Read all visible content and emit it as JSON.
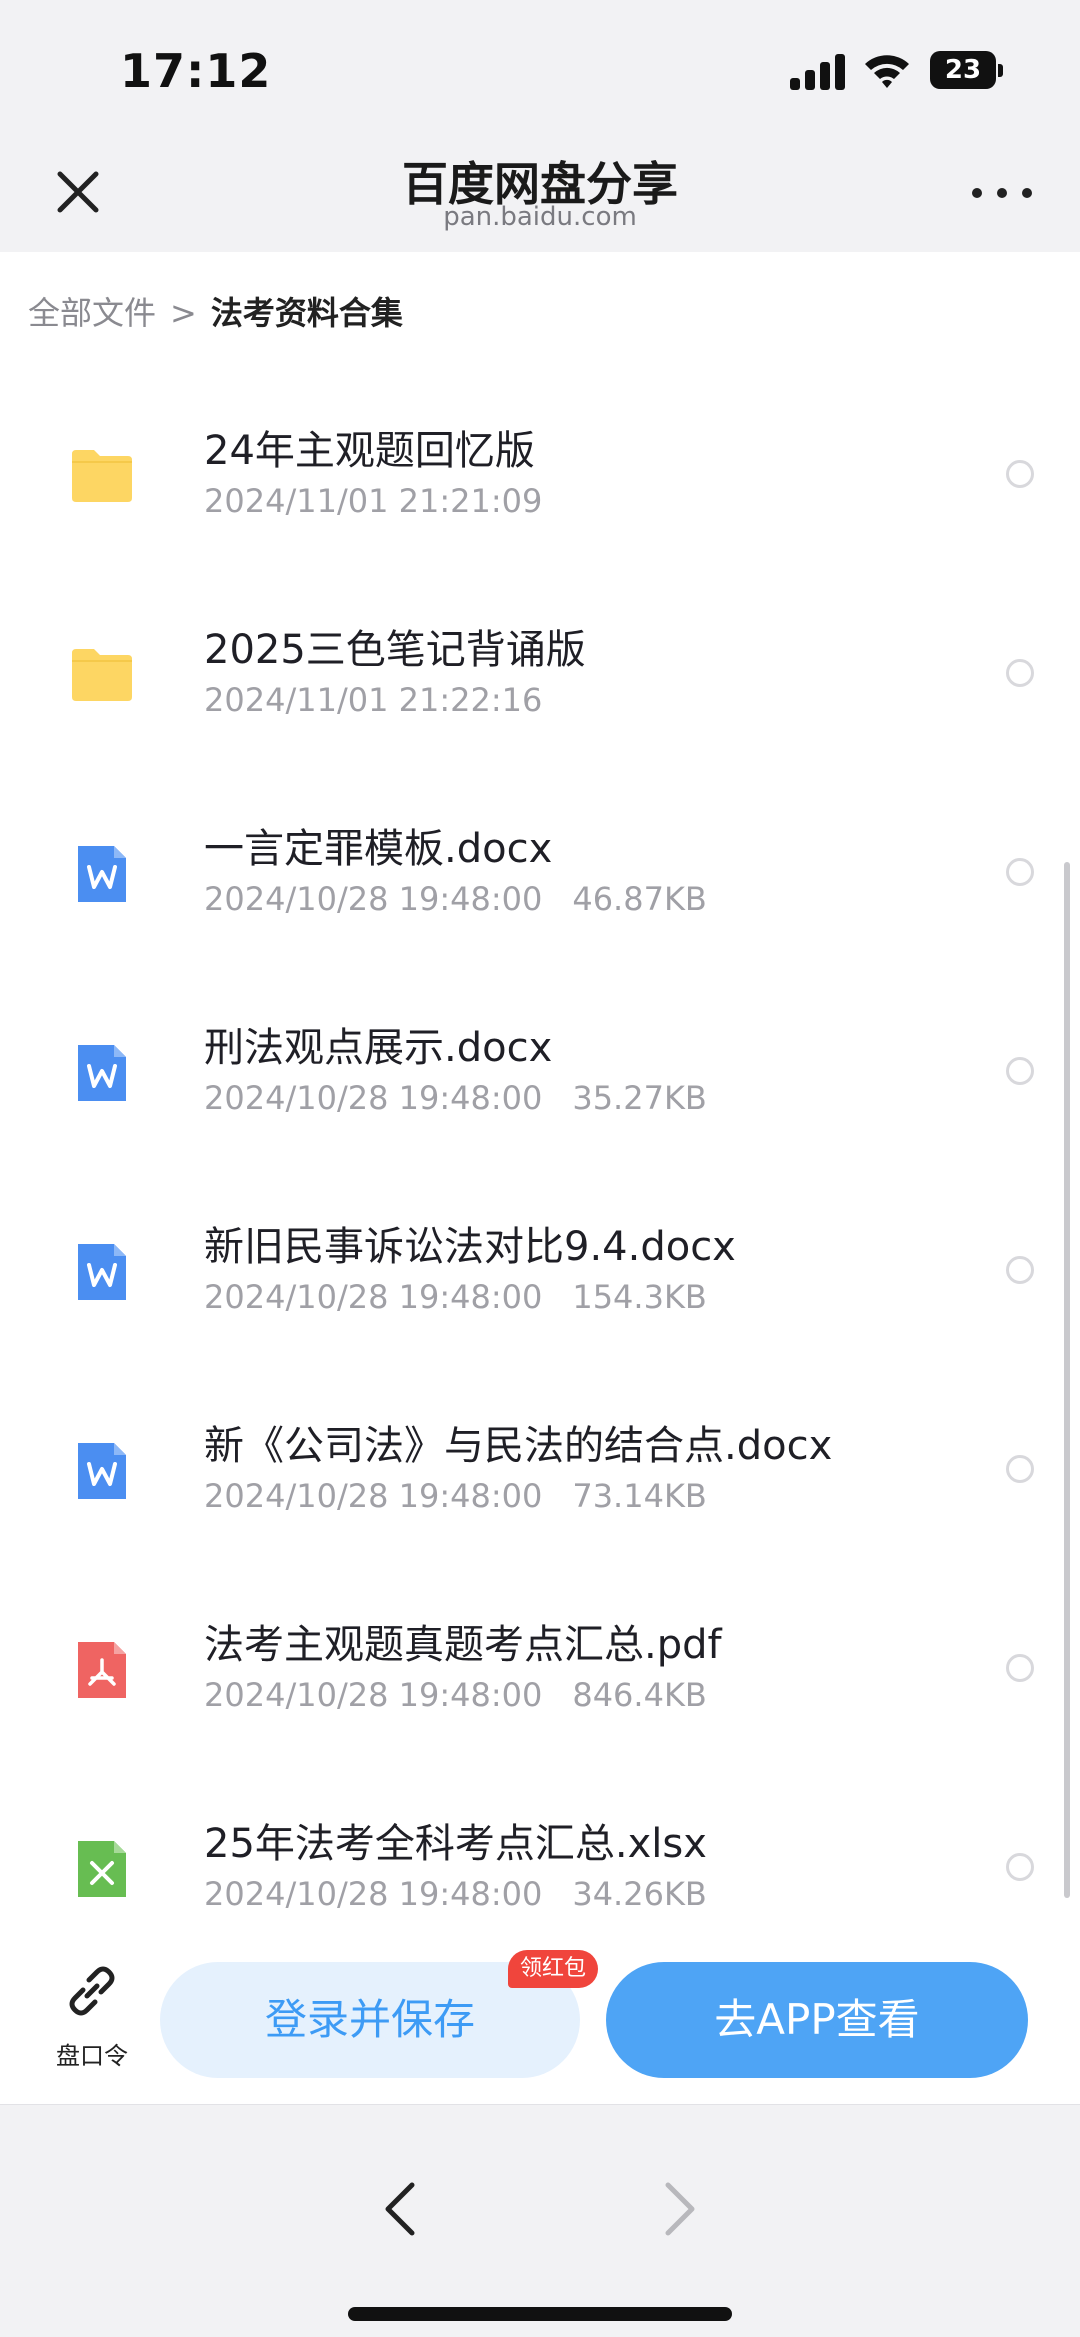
{
  "status_bar": {
    "time": "17:12",
    "battery": "23"
  },
  "header": {
    "title": "百度网盘分享",
    "subtitle": "pan.baidu.com"
  },
  "breadcrumb": {
    "root": "全部文件",
    "separator": ">",
    "current": "法考资料合集"
  },
  "files": [
    {
      "name": "24年主观题回忆版",
      "date": "2024/11/01 21:21:09",
      "size": "",
      "icon": "folder-icon"
    },
    {
      "name": "2025三色笔记背诵版",
      "date": "2024/11/01 21:22:16",
      "size": "",
      "icon": "folder-icon"
    },
    {
      "name": "一言定罪模板.docx",
      "date": "2024/10/28 19:48:00",
      "size": "46.87KB",
      "icon": "word-doc-icon"
    },
    {
      "name": "刑法观点展示.docx",
      "date": "2024/10/28 19:48:00",
      "size": "35.27KB",
      "icon": "word-doc-icon"
    },
    {
      "name": "新旧民事诉讼法对比9.4.docx",
      "date": "2024/10/28 19:48:00",
      "size": "154.3KB",
      "icon": "word-doc-icon"
    },
    {
      "name": "新《公司法》与民法的结合点.docx",
      "date": "2024/10/28 19:48:00",
      "size": "73.14KB",
      "icon": "word-doc-icon"
    },
    {
      "name": "法考主观题真题考点汇总.pdf",
      "date": "2024/10/28 19:48:00",
      "size": "846.4KB",
      "icon": "pdf-icon"
    },
    {
      "name": "25年法考全科考点汇总.xlsx",
      "date": "2024/10/28 19:48:00",
      "size": "34.26KB",
      "icon": "excel-icon"
    }
  ],
  "actions": {
    "pan_token_label": "盘口令",
    "login_save": "登录并保存",
    "badge": "领红包",
    "open_app": "去APP查看"
  },
  "colors": {
    "folder": "#FDD663",
    "word": "#4B8EF1",
    "pdf": "#EF6462",
    "excel": "#67BD52",
    "primary": "#4EA4F5",
    "badge": "#F0453C"
  }
}
